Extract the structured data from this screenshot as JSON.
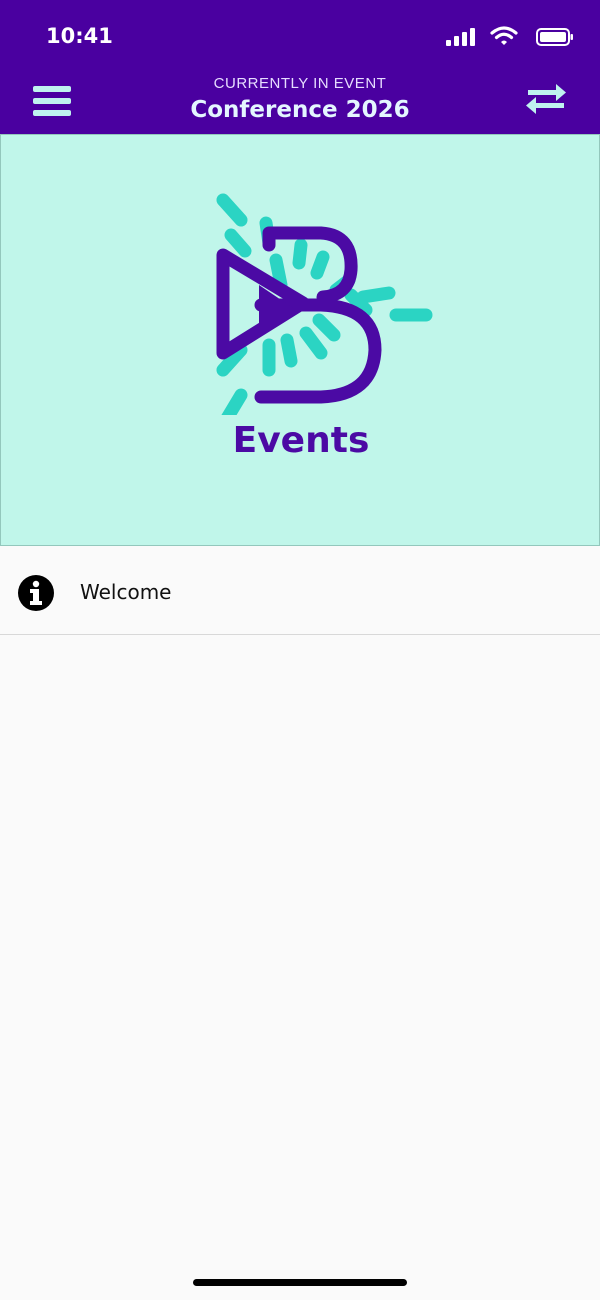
{
  "status_bar": {
    "time": "10:41",
    "icons": [
      "signal-icon",
      "wifi-icon",
      "battery-icon"
    ]
  },
  "header": {
    "subtitle": "CURRENTLY IN EVENT",
    "title": "Conference 2026",
    "left_icon": "menu-icon",
    "right_icon": "swap-icon",
    "background_color": "#4a00a0"
  },
  "banner": {
    "brand_text": "Events",
    "background_color": "#c0f6ea",
    "logo_colors": {
      "primary": "#4b0aa4",
      "accent": "#2bd4c3"
    }
  },
  "menu_items": [
    {
      "icon": "info-icon",
      "label": "Welcome"
    }
  ]
}
